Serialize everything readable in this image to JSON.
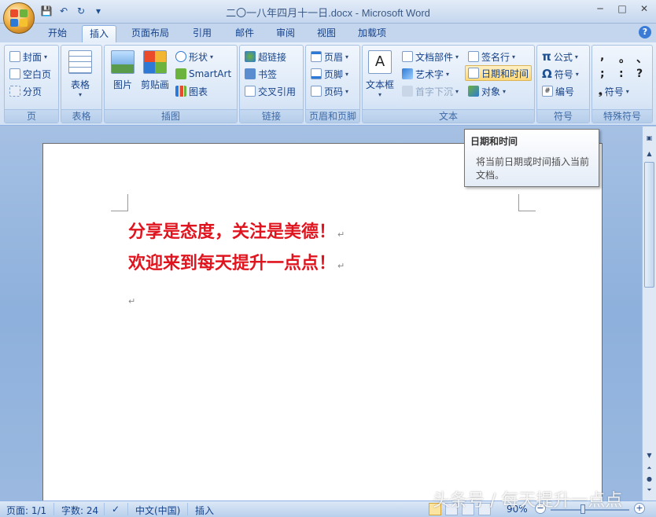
{
  "window": {
    "title": "二〇一八年四月十一日.docx - Microsoft Word",
    "minimize": "─",
    "maximize": "□",
    "close": "✕"
  },
  "qat": {
    "save": "💾",
    "undo": "↶",
    "redo": "↻",
    "customize": "▾"
  },
  "tabs": [
    {
      "label": "开始"
    },
    {
      "label": "插入"
    },
    {
      "label": "页面布局"
    },
    {
      "label": "引用"
    },
    {
      "label": "邮件"
    },
    {
      "label": "审阅"
    },
    {
      "label": "视图"
    },
    {
      "label": "加载项"
    }
  ],
  "active_tab": "插入",
  "help": "?",
  "ribbon": {
    "pages": {
      "name": "页",
      "cover": "封面",
      "blank": "空白页",
      "break": "分页"
    },
    "tables": {
      "name": "表格",
      "table": "表格"
    },
    "illustrations": {
      "name": "插图",
      "picture": "图片",
      "clipart": "剪贴画",
      "shapes": "形状",
      "smartart": "SmartArt",
      "chart": "图表"
    },
    "links": {
      "name": "链接",
      "hyperlink": "超链接",
      "bookmark": "书签",
      "crossref": "交叉引用"
    },
    "headerfooter": {
      "name": "页眉和页脚",
      "header": "页眉",
      "footer": "页脚",
      "pagenum": "页码"
    },
    "text": {
      "name": "文本",
      "textbox": "文本框",
      "quickparts": "文档部件",
      "wordart": "艺术字",
      "dropcap": "首字下沉",
      "signature": "签名行",
      "datetime": "日期和时间",
      "object": "对象"
    },
    "symbols": {
      "name": "符号",
      "equation": "公式",
      "symbol": "符号",
      "number": "编号"
    },
    "special": {
      "name": "特殊符号",
      "more": "符号",
      "chars": [
        ",",
        "。",
        "、",
        ";",
        ":",
        "?"
      ]
    }
  },
  "tooltip": {
    "title": "日期和时间",
    "body": "将当前日期或时间插入当前文档。"
  },
  "document": {
    "line1": "分享是态度，关注是美德！",
    "line2": "欢迎来到每天提升一点点！",
    "mark": "↵"
  },
  "status": {
    "page": "页面: 1/1",
    "words": "字数: 24",
    "lang": "中文(中国)",
    "mode": "插入",
    "zoom": "90%"
  },
  "watermark": "头条号 / 每天提升一点点",
  "colors": {
    "doc_text": "#e0141e",
    "ribbon": "#d2e1f4",
    "accent": "#15428b"
  }
}
